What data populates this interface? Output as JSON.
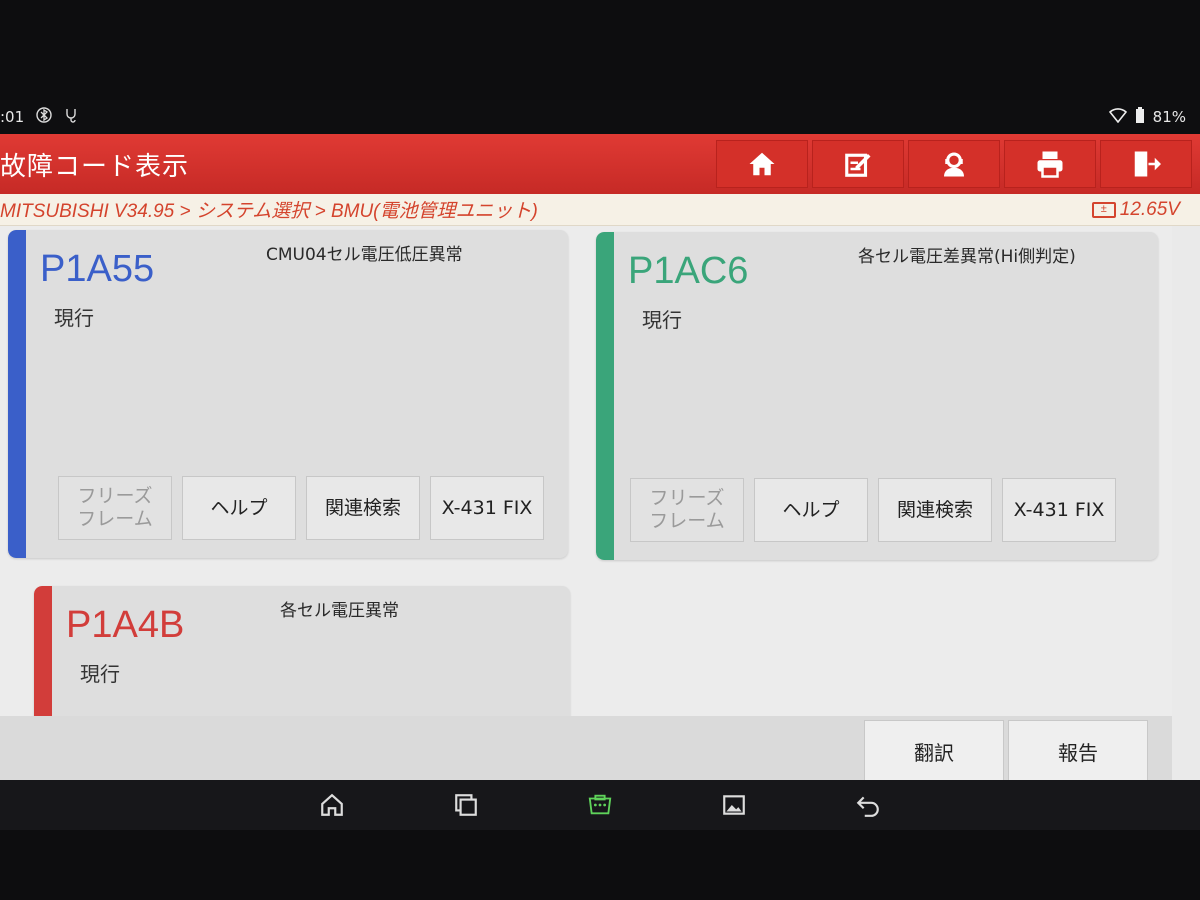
{
  "status_bar": {
    "time": ":01",
    "battery": "81%"
  },
  "header": {
    "title": "故障コード表示",
    "buttons": [
      "home-icon",
      "edit-icon",
      "support-icon",
      "print-icon",
      "exit-icon"
    ]
  },
  "breadcrumb": {
    "path": "MITSUBISHI V34.95 > システム選択 > BMU(電池管理ユニット)",
    "voltage": "12.65V"
  },
  "cards": [
    {
      "code": "P1A55",
      "description": "CMU04セル電圧低圧異常",
      "status": "現行",
      "color": "#3a5fc9",
      "buttons": [
        "フリーズ\nフレーム",
        "ヘルプ",
        "関連検索",
        "X-431 FIX"
      ]
    },
    {
      "code": "P1AC6",
      "description": "各セル電圧差異常(Hi側判定)",
      "status": "現行",
      "color": "#3aa57a",
      "buttons": [
        "フリーズ\nフレーム",
        "ヘルプ",
        "関連検索",
        "X-431 FIX"
      ]
    },
    {
      "code": "P1A4B",
      "description": "各セル電圧異常",
      "status": "現行",
      "color": "#d23d3a"
    }
  ],
  "bottom": {
    "translate_label": "翻訳",
    "report_label": "報告"
  },
  "colors": {
    "header_red": "#d43029",
    "breadcrumb_orange": "#d4442d"
  }
}
